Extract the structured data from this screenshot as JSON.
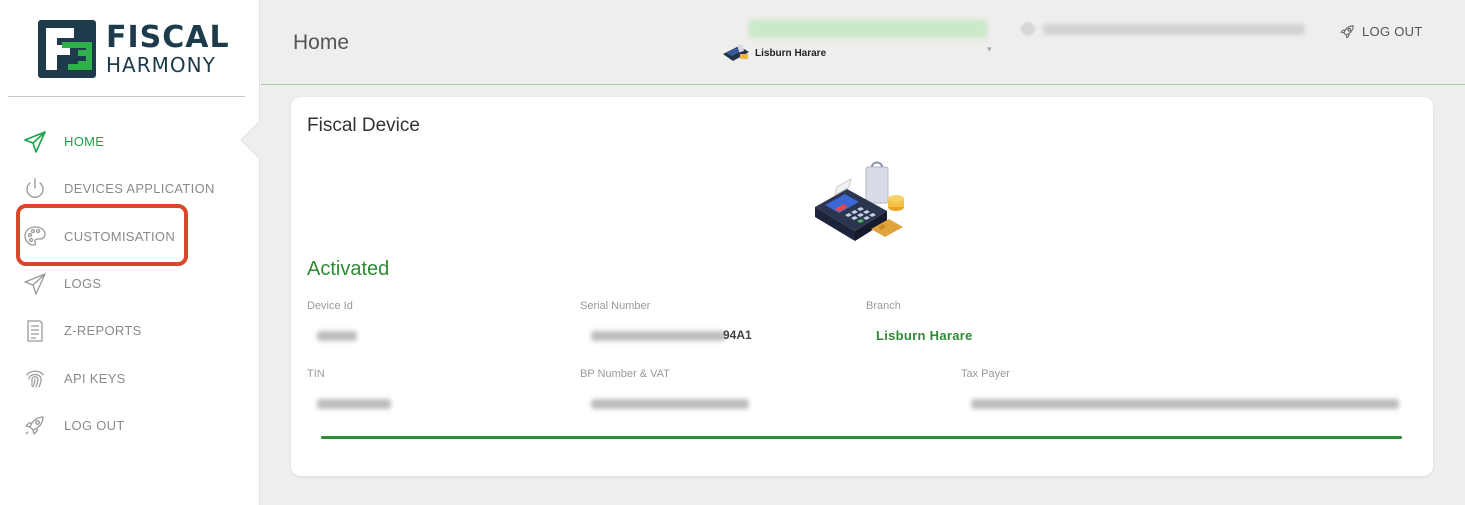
{
  "logo": {
    "line1": "FISCAL",
    "line2": "HARMONY"
  },
  "sidebar": {
    "items": [
      {
        "label": "HOME",
        "icon": "paper-plane-icon",
        "active": true
      },
      {
        "label": "DEVICES APPLICATION",
        "icon": "power-icon",
        "active": false
      },
      {
        "label": "CUSTOMISATION",
        "icon": "palette-icon",
        "active": false
      },
      {
        "label": "LOGS",
        "icon": "paper-plane-outline-icon",
        "active": false
      },
      {
        "label": "Z-REPORTS",
        "icon": "document-icon",
        "active": false
      },
      {
        "label": "API KEYS",
        "icon": "fingerprint-icon",
        "active": false
      },
      {
        "label": "LOG OUT",
        "icon": "rocket-icon",
        "active": false
      }
    ]
  },
  "header": {
    "title": "Home",
    "branch": "Lisburn Harare",
    "logout_label": "LOG OUT"
  },
  "device": {
    "title": "Fiscal Device",
    "status": "Activated",
    "labels": {
      "device_id": "Device Id",
      "serial": "Serial Number",
      "branch": "Branch",
      "tin": "TIN",
      "bp_vat": "BP Number & VAT",
      "taxpayer": "Tax Payer"
    },
    "serial_visible_suffix": "94A1",
    "branch_value": "Lisburn Harare"
  },
  "colors": {
    "accent_green": "#2e8b33",
    "active_nav_green": "#1aa34a",
    "highlight_red": "#d9472b",
    "logo_navy": "#1d3b4a"
  }
}
